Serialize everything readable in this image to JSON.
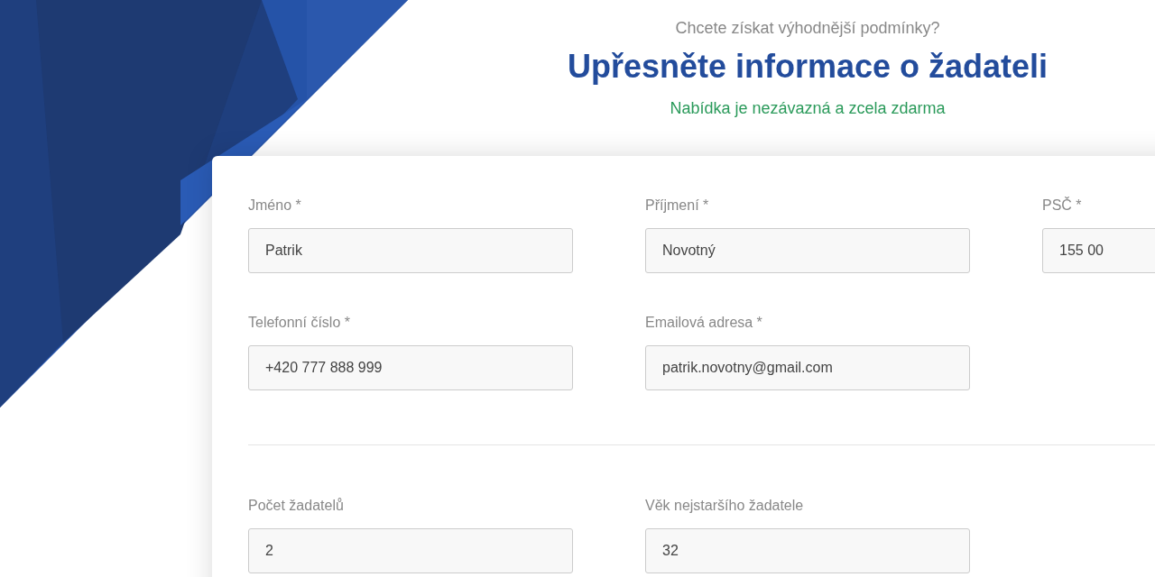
{
  "header": {
    "subtitle": "Chcete získat výhodnější podmínky?",
    "title": "Upřesněte informace o žadateli",
    "tagline": "Nabídka je nezávazná a zcela zdarma"
  },
  "sections": [
    {
      "fields": [
        {
          "label": "Jméno *",
          "value": "Patrik"
        },
        {
          "label": "Příjmení *",
          "value": "Novotný"
        },
        {
          "label": "PSČ *",
          "value": "155 00"
        },
        {
          "label": "Telefonní číslo *",
          "value": "+420 777 888 999"
        },
        {
          "label": "Emailová adresa *",
          "value": "patrik.novotny@gmail.com"
        }
      ]
    },
    {
      "fields": [
        {
          "label": "Počet žadatelů",
          "value": "2"
        },
        {
          "label": "Věk nejstaršího žadatele",
          "value": "32"
        }
      ]
    }
  ]
}
